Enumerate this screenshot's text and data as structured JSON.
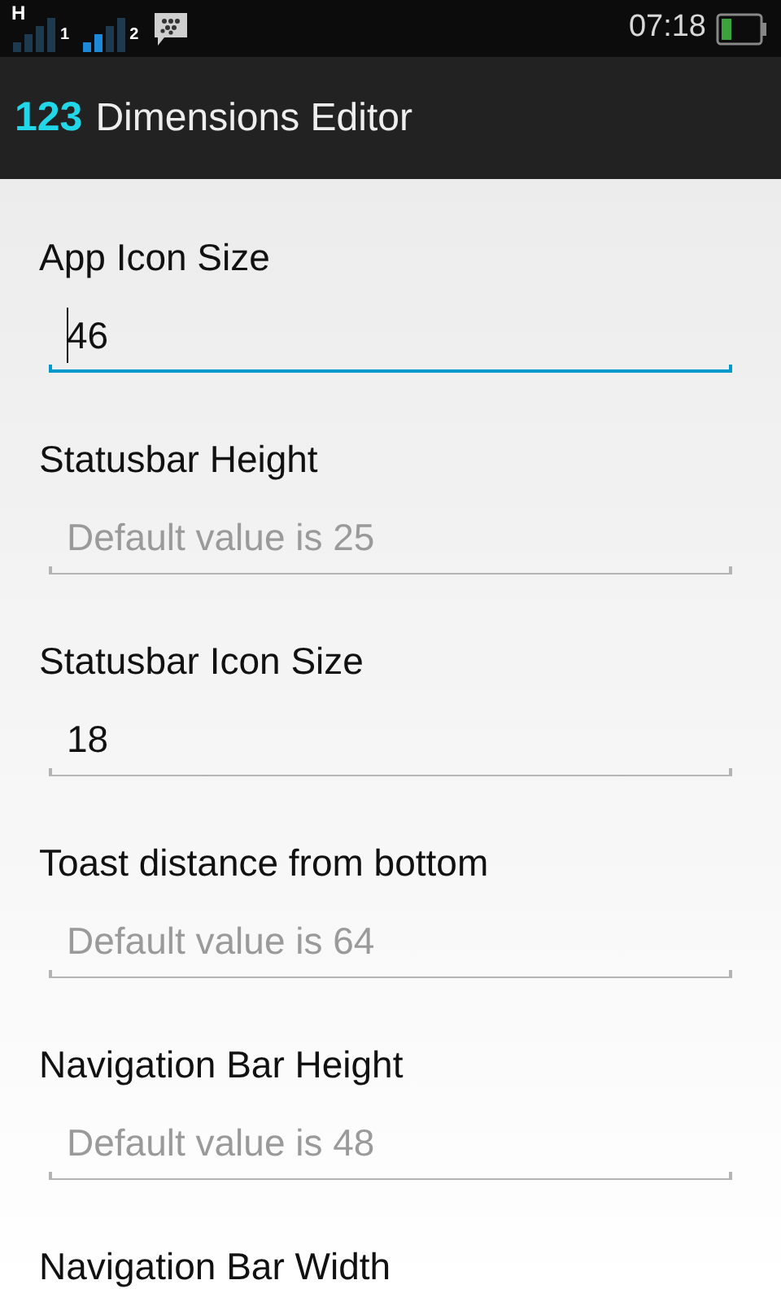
{
  "status_bar": {
    "network_type": "H",
    "sim_1": "1",
    "sim_2": "2",
    "time": "07:18"
  },
  "action_bar": {
    "logo": "123",
    "title": "Dimensions Editor"
  },
  "fields": [
    {
      "label": "App Icon Size",
      "value": "46",
      "focused": true
    },
    {
      "label": "Statusbar Height",
      "placeholder": "Default value is 25",
      "focused": false
    },
    {
      "label": "Statusbar Icon Size",
      "value": "18",
      "focused": false
    },
    {
      "label": "Toast distance from bottom",
      "placeholder": "Default value is 64",
      "focused": false
    },
    {
      "label": "Navigation Bar Height",
      "placeholder": "Default value is 48",
      "focused": false
    },
    {
      "label": "Navigation Bar Width"
    }
  ]
}
